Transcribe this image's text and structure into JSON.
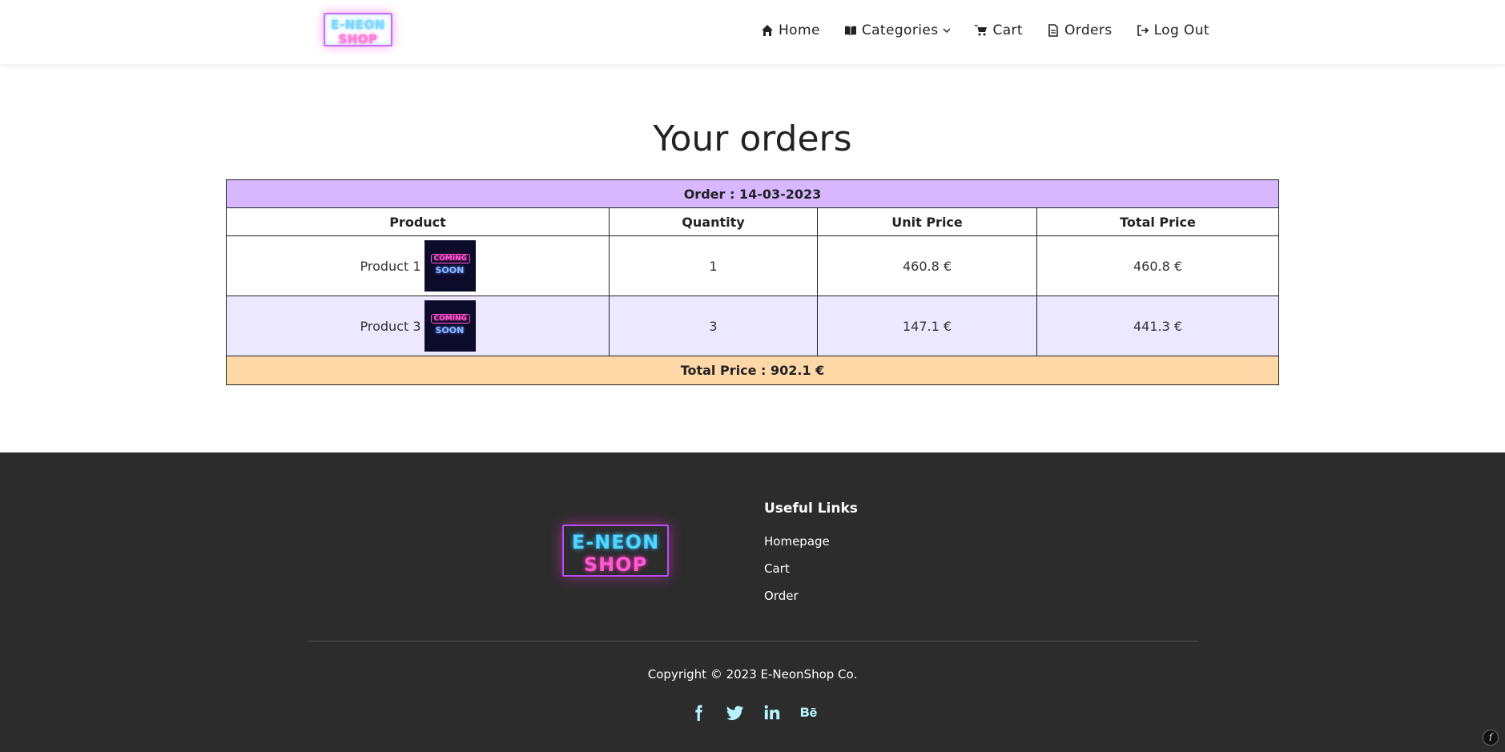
{
  "navbar": {
    "logo": {
      "line1": "E-NEON",
      "line2": "SHOP"
    },
    "items": [
      {
        "label": "Home",
        "icon": "home-icon"
      },
      {
        "label": "Categories",
        "icon": "book-icon"
      },
      {
        "label": "Cart",
        "icon": "cart-icon"
      },
      {
        "label": "Orders",
        "icon": "file-icon"
      },
      {
        "label": "Log Out",
        "icon": "logout-icon"
      }
    ]
  },
  "main": {
    "title": "Your orders",
    "order": {
      "header": "Order : 14-03-2023",
      "columns": [
        "Product",
        "Quantity",
        "Unit Price",
        "Total Price"
      ],
      "rows": [
        {
          "product": "Product 1",
          "quantity": "1",
          "unit_price": "460.8 €",
          "total_price": "460.8 €"
        },
        {
          "product": "Product 3",
          "quantity": "3",
          "unit_price": "147.1 €",
          "total_price": "441.3 €"
        }
      ],
      "total": "Total Price : 902.1 €"
    },
    "thumb": {
      "line1": "COMING",
      "line2": "SOON"
    }
  },
  "footer": {
    "logo": {
      "line1": "E-NEON",
      "line2": "SHOP"
    },
    "useful_title": "Useful Links",
    "links": [
      "Homepage",
      "Cart",
      "Order"
    ],
    "copyright": "Copyright © 2023 E-NeonShop Co.",
    "socials": [
      "facebook-icon",
      "twitter-icon",
      "linkedin-icon",
      "behance-icon"
    ]
  },
  "colors": {
    "order_header_bg": "#d7b7ff",
    "alt_row_bg": "#ebe8ff",
    "total_row_bg": "#ffd8a8",
    "footer_bg": "#2c2c2c",
    "social_icon": "#b8f4ff"
  }
}
